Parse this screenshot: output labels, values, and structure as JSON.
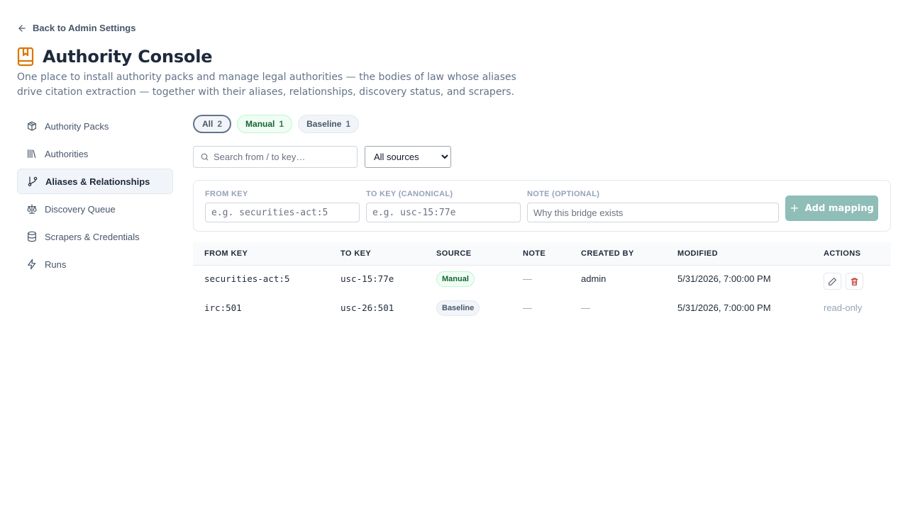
{
  "nav": {
    "back_label": "Back to Admin Settings"
  },
  "header": {
    "title": "Authority Console",
    "subtitle": "One place to install authority packs and manage legal authorities — the bodies of law whose aliases drive citation extraction — together with their aliases, relationships, discovery status, and scrapers."
  },
  "sidebar": {
    "items": [
      {
        "label": "Authority Packs",
        "icon": "package-icon",
        "active": false
      },
      {
        "label": "Authorities",
        "icon": "library-icon",
        "active": false
      },
      {
        "label": "Aliases & Relationships",
        "icon": "git-branch-icon",
        "active": true
      },
      {
        "label": "Discovery Queue",
        "icon": "scale-icon",
        "active": false
      },
      {
        "label": "Scrapers & Credentials",
        "icon": "database-icon",
        "active": false
      },
      {
        "label": "Runs",
        "icon": "zap-icon",
        "active": false
      }
    ]
  },
  "filter_chips": [
    {
      "label": "All",
      "count": "2"
    },
    {
      "label": "Manual",
      "count": "1"
    },
    {
      "label": "Baseline",
      "count": "1"
    }
  ],
  "search": {
    "placeholder": "Search from / to key…",
    "value": ""
  },
  "source_filter": {
    "selected": "All sources"
  },
  "form": {
    "from_key": {
      "label": "FROM KEY",
      "placeholder": "e.g. securities-act:5"
    },
    "to_key": {
      "label": "TO KEY (CANONICAL)",
      "placeholder": "e.g. usc-15:77e"
    },
    "note": {
      "label": "NOTE (OPTIONAL)",
      "placeholder": "Why this bridge exists"
    },
    "add_label": "Add mapping"
  },
  "table": {
    "columns": [
      "FROM KEY",
      "TO KEY",
      "SOURCE",
      "NOTE",
      "CREATED BY",
      "MODIFIED",
      "ACTIONS"
    ],
    "rows": [
      {
        "from": "securities-act:5",
        "to": "usc-15:77e",
        "source": "Manual",
        "note": "—",
        "created_by": "admin",
        "modified": "5/31/2026, 7:00:00 PM",
        "actions": ""
      },
      {
        "from": "irc:501",
        "to": "usc-26:501",
        "source": "Baseline",
        "note": "—",
        "created_by": "—",
        "modified": "5/31/2026, 7:00:00 PM",
        "actions": "read-only"
      }
    ]
  },
  "colors": {
    "accent_orange": "#d97706",
    "button_teal": "#8fbdb7",
    "manual_green": "#166534",
    "delete_red": "#b91c1c"
  }
}
